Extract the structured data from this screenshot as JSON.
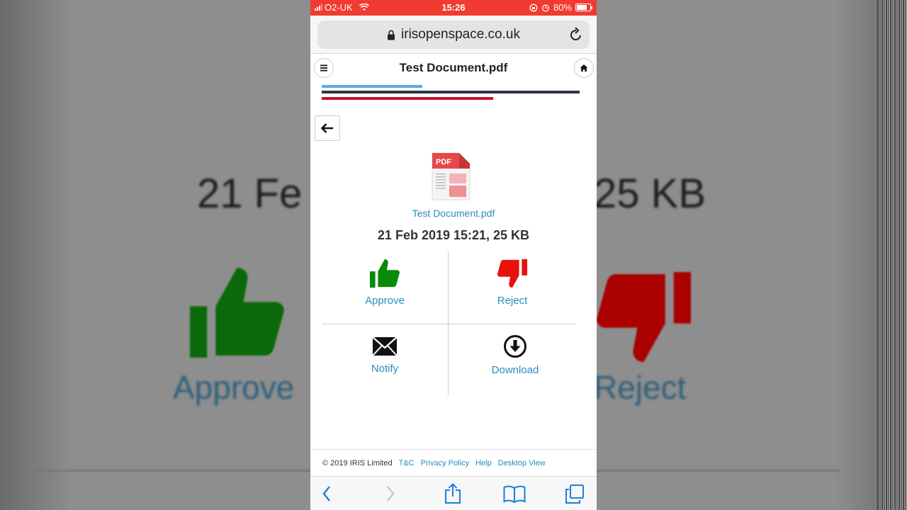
{
  "background": {
    "date_text_left": "21 Fe",
    "date_text_right": "25 KB",
    "approve_text": "Approve",
    "reject_text": "Reject"
  },
  "status_bar": {
    "carrier": "O2-UK",
    "time": "15:26",
    "battery": "80%",
    "battery_level": 0.8,
    "color": "#f23b30"
  },
  "browser": {
    "url": "irisopenspace.co.uk"
  },
  "app_header": {
    "title": "Test Document.pdf"
  },
  "progress_stripes": {
    "colors": [
      "#5aaedc",
      "#2e3440",
      "#c8102e"
    ]
  },
  "document": {
    "file_name": "Test Document.pdf",
    "meta": "21 Feb 2019 15:21, 25 KB",
    "icon_badge": "PDF"
  },
  "actions": {
    "approve": {
      "label": "Approve",
      "icon": "thumbs-up-icon",
      "color": "#0a8a0a"
    },
    "reject": {
      "label": "Reject",
      "icon": "thumbs-down-icon",
      "color": "#e8120c"
    },
    "notify": {
      "label": "Notify",
      "icon": "envelope-icon"
    },
    "download": {
      "label": "Download",
      "icon": "download-circle-icon"
    }
  },
  "footer": {
    "copyright": "© 2019 IRIS Limited",
    "links": [
      "T&C",
      "Privacy Policy",
      "Help",
      "Desktop View"
    ]
  }
}
